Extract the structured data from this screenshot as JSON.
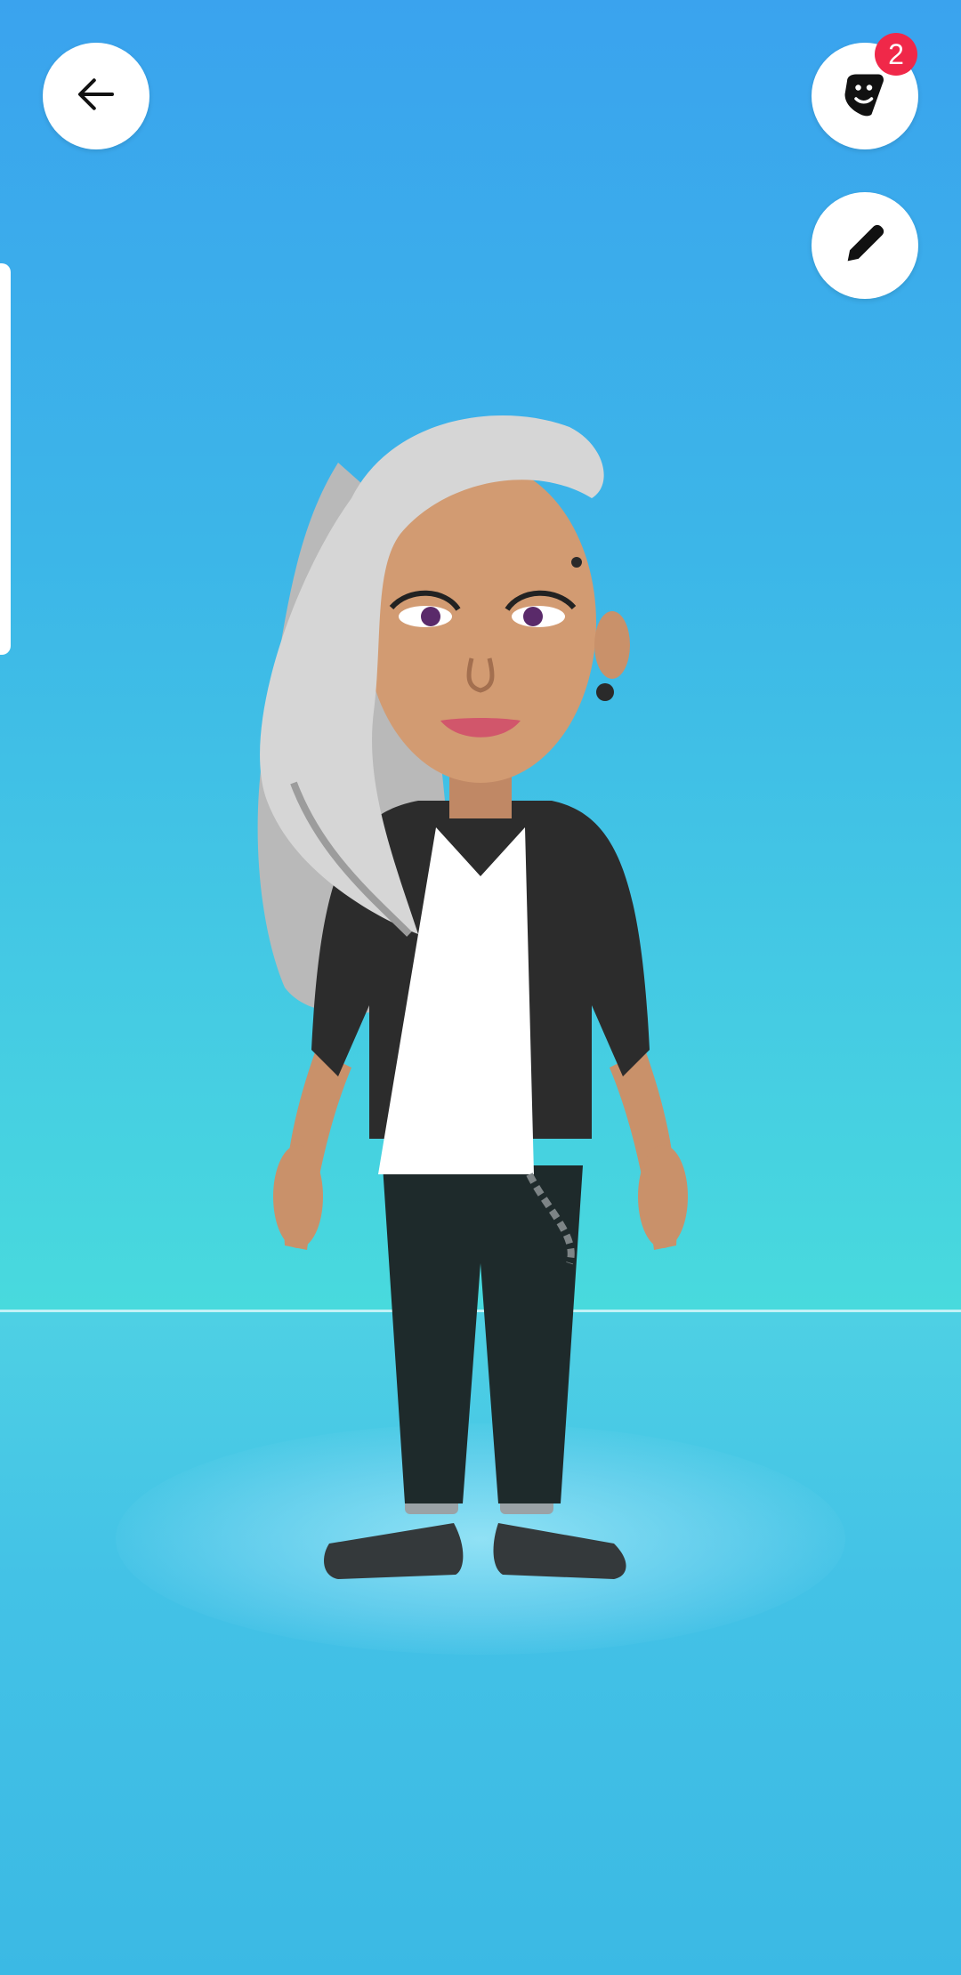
{
  "header": {
    "back_icon": "arrow-left-icon",
    "sticker_icon": "sticker-face-icon",
    "sticker_badge_count": "2",
    "edit_icon": "pencil-icon"
  },
  "avatar": {
    "description_icon": "avatar-figure"
  },
  "colors": {
    "sky_top": "#3aa3ee",
    "sky_horizon": "#48dadd",
    "badge": "#f02849",
    "button_bg": "#ffffff"
  }
}
